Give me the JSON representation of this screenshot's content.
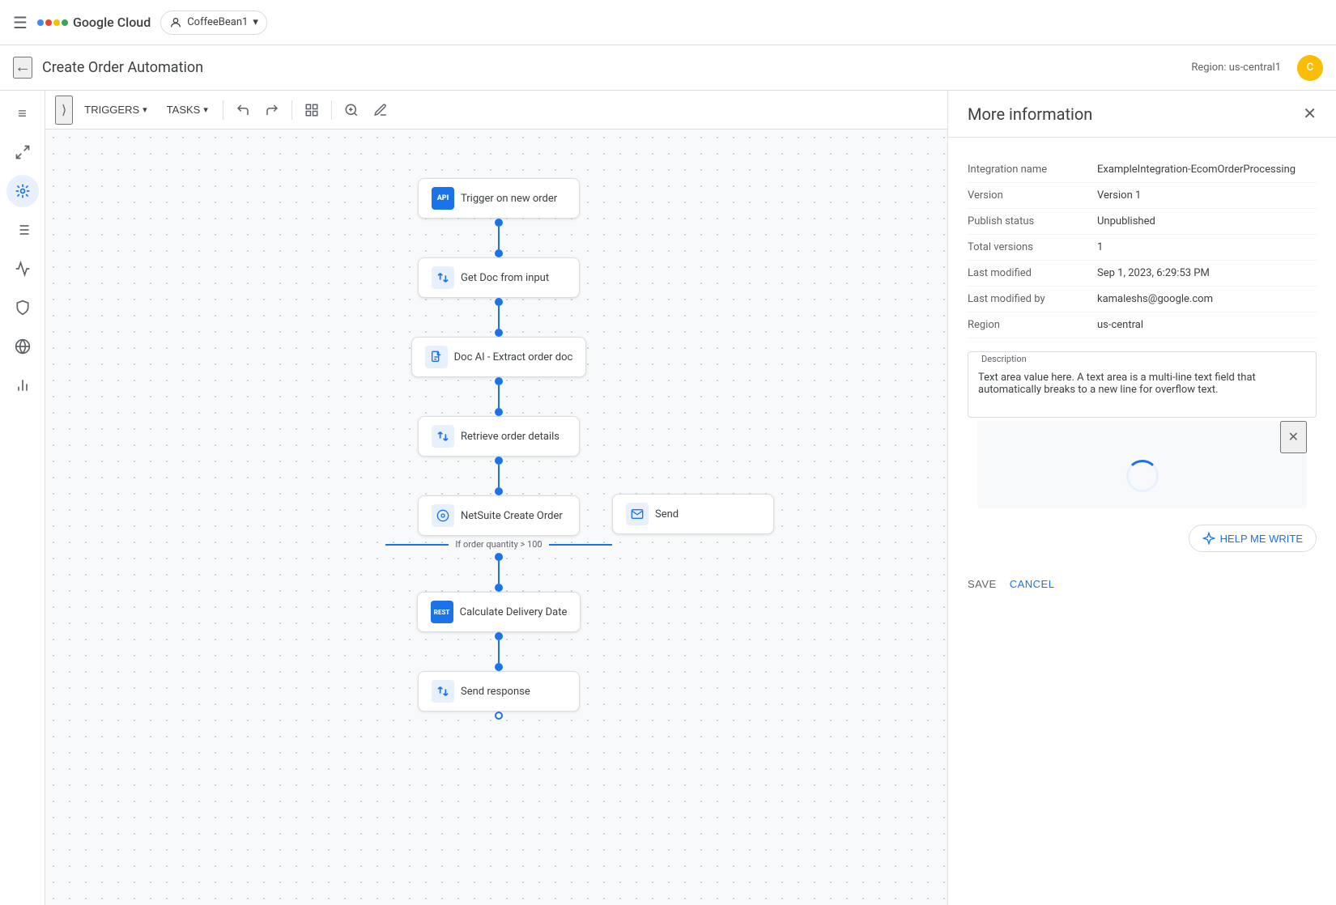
{
  "topbar": {
    "hamburger_icon": "☰",
    "logo_text": "Google Cloud",
    "project": {
      "name": "CoffeeBean1",
      "dropdown_icon": "▾"
    }
  },
  "page": {
    "back_icon": "←",
    "title": "Create Order Automation",
    "region_label": "Region: us-central1",
    "avatar_letter": "C"
  },
  "editor_toolbar": {
    "collapse_icon": "⟩",
    "triggers_label": "TRIGGERS",
    "tasks_label": "TASKS",
    "undo_icon": "↩",
    "redo_icon": "↪",
    "layout_icon": "⊞",
    "zoom_icon": "⊕",
    "pen_icon": "✏"
  },
  "sidebar_icons": [
    "≡",
    "↙",
    "▶",
    "☰",
    "📈",
    "🔒",
    "🌐",
    "📊"
  ],
  "flow_nodes": [
    {
      "id": "trigger",
      "icon": "API",
      "label": "Trigger on new order",
      "icon_type": "api"
    },
    {
      "id": "get-doc",
      "icon": "↔",
      "label": "Get Doc from input",
      "icon_type": "arrows"
    },
    {
      "id": "doc-ai",
      "icon": "📄",
      "label": "Doc AI - Extract order doc",
      "icon_type": "doc"
    },
    {
      "id": "retrieve",
      "icon": "↔",
      "label": "Retrieve order details",
      "icon_type": "arrows"
    },
    {
      "id": "netsuite",
      "icon": "⊙",
      "label": "NetSuite Create Order",
      "icon_type": "netsuite"
    },
    {
      "id": "calculate",
      "icon": "REST",
      "label": "Calculate Delivery Date",
      "icon_type": "rest"
    },
    {
      "id": "send-resp",
      "icon": "↔",
      "label": "Send response",
      "icon_type": "arrows"
    }
  ],
  "branch_label": "If order quantity > 100",
  "send_label": "Send",
  "right_panel": {
    "title": "More information",
    "close_icon": "✕",
    "fields": [
      {
        "label": "Integration name",
        "value": "ExampleIntegration-EcomOrderProcessing"
      },
      {
        "label": "Version",
        "value": "Version 1"
      },
      {
        "label": "Publish status",
        "value": "Unpublished"
      },
      {
        "label": "Total versions",
        "value": "1"
      },
      {
        "label": "Last modified",
        "value": "Sep 1, 2023, 6:29:53 PM"
      },
      {
        "label": "Last modified by",
        "value": "kamaleshs@google.com"
      },
      {
        "label": "Region",
        "value": "us-central"
      }
    ],
    "description_label": "Description",
    "description_value": "Text area value here. A text area is a multi-line text field that automatically breaks to a new line for overflow text.",
    "spinner_close_icon": "✕",
    "help_me_write_icon": "✦",
    "help_me_write_label": "HELP ME WRITE",
    "save_label": "SAVE",
    "cancel_label": "CANCEL"
  }
}
